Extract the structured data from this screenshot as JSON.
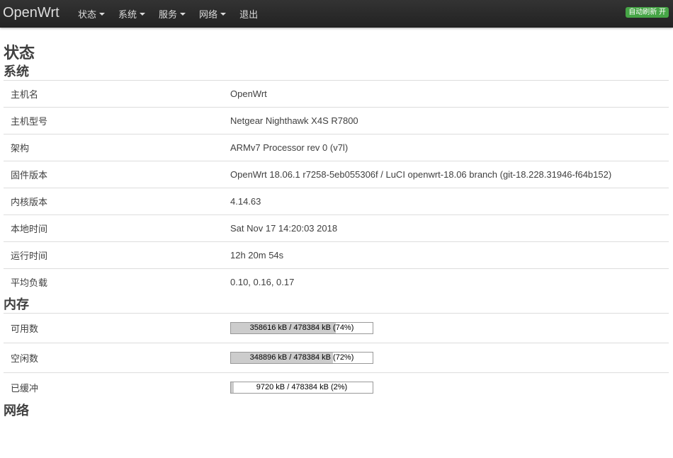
{
  "header": {
    "brand": "OpenWrt",
    "menu": [
      "状态",
      "系统",
      "服务",
      "网络",
      "退出"
    ],
    "auto_refresh": "自动刷新 开"
  },
  "page_title": "状态",
  "system": {
    "title": "系统",
    "rows": [
      {
        "label": "主机名",
        "value": "OpenWrt"
      },
      {
        "label": "主机型号",
        "value": "Netgear Nighthawk X4S R7800"
      },
      {
        "label": "架构",
        "value": "ARMv7 Processor rev 0 (v7l)"
      },
      {
        "label": "固件版本",
        "value": "OpenWrt 18.06.1 r7258-5eb055306f / LuCI openwrt-18.06 branch (git-18.228.31946-f64b152)"
      },
      {
        "label": "内核版本",
        "value": "4.14.63"
      },
      {
        "label": "本地时间",
        "value": "Sat Nov 17 14:20:03 2018"
      },
      {
        "label": "运行时间",
        "value": "12h 20m 54s"
      },
      {
        "label": "平均负载",
        "value": "0.10, 0.16, 0.17"
      }
    ]
  },
  "memory": {
    "title": "内存",
    "rows": [
      {
        "label": "可用数",
        "text": "358616 kB / 478384 kB (74%)",
        "percent": 74
      },
      {
        "label": "空闲数",
        "text": "348896 kB / 478384 kB (72%)",
        "percent": 72
      },
      {
        "label": "已缓冲",
        "text": "9720 kB / 478384 kB (2%)",
        "percent": 2
      }
    ]
  },
  "network": {
    "title": "网络"
  },
  "colors": {
    "navbar": "#222222",
    "badge": "#46a546",
    "bar_fill": "#cccccc"
  }
}
